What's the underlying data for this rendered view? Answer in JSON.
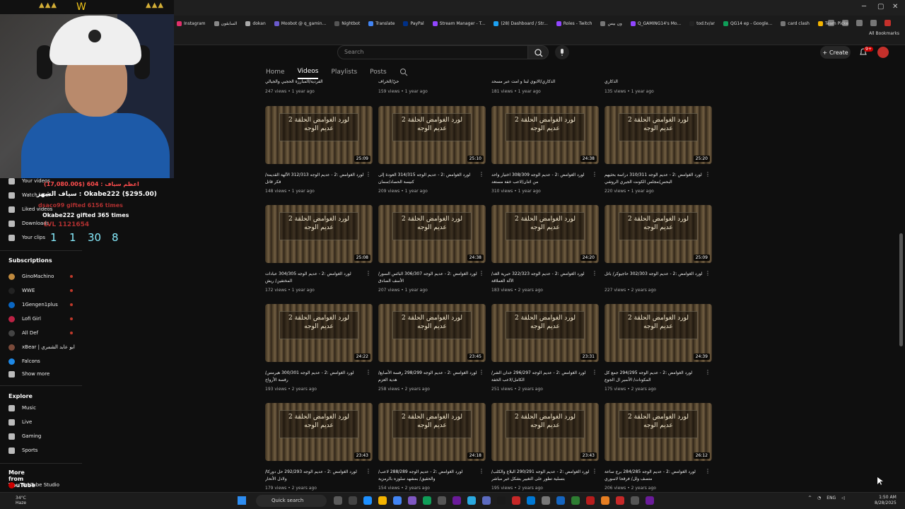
{
  "browser": {
    "bookmarks": [
      "Instagram",
      "السابقون",
      "dokan",
      "Moobot @ q_gamin...",
      "Nightbot",
      "Translate",
      "PayPal",
      "Stream Manager - T...",
      "(28) Dashboard / Str...",
      "Roles - Twitch",
      "ون بيس",
      "Q_GAMING14's Mo...",
      "tod.tv/ar",
      "QG14 ep - Google...",
      "card clash",
      "Team Picker Wheel...",
      "Kick"
    ],
    "all_bookmarks": "All Bookmarks"
  },
  "header": {
    "search_placeholder": "Search",
    "create_label": "Create",
    "notifications_count": "9+"
  },
  "channel_tabs": [
    "Home",
    "Videos",
    "Playlists",
    "Posts"
  ],
  "overlay": {
    "donation_1": "اعظم سياف : 604 ($17,080.00)",
    "donation_2": "سياف الشهر : Okabe222 ($295.00)",
    "gift_1": "dsaco99 gifted 6156 times",
    "gift_2": "Okabe222 gifted 365 times",
    "level": "LVL 1121654",
    "counter_1": "1",
    "counter_2": "1",
    "counter_3": "30",
    "counter_4": "8"
  },
  "sidebar": {
    "you_items": [
      "Your videos",
      "Watch later",
      "Liked videos",
      "Downloads",
      "Your clips"
    ],
    "subscriptions_title": "Subscriptions",
    "subscriptions": [
      "GinoMachino",
      "WWE",
      "1Gengen1plus",
      "Lofi Girl",
      "All Def",
      "xBear | ابو عابد الشمري",
      "Falcons"
    ],
    "show_more": "Show more",
    "explore_title": "Explore",
    "explore": [
      "Music",
      "Live",
      "Gaming",
      "Sports"
    ],
    "more_title": "More from YouTube",
    "more": [
      "YouTube Studio"
    ]
  },
  "top_row": [
    {
      "title": "الفردية/المبارزة الحجبي والجيالي",
      "meta": "247 views • 1 year ago"
    },
    {
      "title": "حيّ/الخراف",
      "meta": "159 views • 1 year ago"
    },
    {
      "title": "الذكاري/الابوي لبنا و امت عبر مسحد",
      "meta": "181 views • 1 year ago"
    },
    {
      "title": "الذكاري",
      "meta": "135 views • 1 year ago"
    }
  ],
  "thumb_art": "لورد الغوامض الحلقة 2 عديم الوجه",
  "videos": [
    {
      "duration": "25:09",
      "title": "لورد الغوامض :2 - عديم الوجه 312/313 الآلهة القديمة/ فكر قاتل",
      "meta": "148 views • 1 year ago"
    },
    {
      "duration": "25:10",
      "title": "لورد الغوامض :2 - عديم الوجه 314/315 العودة إلى كنيسة الحصاد/سمان",
      "meta": "209 views • 1 year ago"
    },
    {
      "duration": "24:38",
      "title": "لورد الغوامض :2 - عديم الوجه 308/309 اختيار واحد من اثنان/لاعب خفة مستعد",
      "meta": "310 views • 1 year ago"
    },
    {
      "duration": "25:20",
      "title": "لورد الغوامض :2 - عديم الوجه 310/311 دراسة بحثيهم البحس/مجلس الكونت الجيري الروشي",
      "meta": "220 views • 1 year ago"
    },
    {
      "duration": "25:08",
      "title": "لورد الغوامض :2 - عديم الوجه 304/305 عبادات المختفين/ ريش",
      "meta": "172 views • 1 year ago"
    },
    {
      "duration": "24:38",
      "title": "لورد الغوامض :2 - عديم الوجه 306/307 البائس السور/ الأسف الصادق",
      "meta": "207 views • 1 year ago"
    },
    {
      "duration": "24:20",
      "title": "لورد الغوامض :2 - عديم الوجه 322/323 حبرية الغد/ الآلة العملاقة",
      "meta": "183 views • 2 years ago"
    },
    {
      "duration": "25:09",
      "title": "لورد الغوامض :2 - عديم الوجه 302/303 حاجيوكر/ باتل",
      "meta": "227 views • 2 years ago"
    },
    {
      "duration": "24:22",
      "title": "لورد الغوامض :2 - عديم الوجه 300/301 هيرمس/ رفسة الأرواح",
      "meta": "193 views • 2 years ago"
    },
    {
      "duration": "23:45",
      "title": "لورد الغوامض :2 - عديم الوجه 298/299 رفسة الأصابع/ هدية العزم",
      "meta": "258 views • 2 years ago"
    },
    {
      "duration": "23:31",
      "title": "لورد الغوامض :2 - عديم الوجه 296/297 خدان الشر/ الكامل/لاعب الخفة",
      "meta": "251 views • 2 years ago"
    },
    {
      "duration": "24:39",
      "title": "لورد الغوامض :2 - عديم الوجه 294/295 جمع كل المكونات/ الأسير ال الجوع",
      "meta": "175 views • 2 years ago"
    },
    {
      "duration": "23:43",
      "title": "لورد الغوامض :2 - عديم الوجه 292/293 حل دوركا/ ولادل الأنحار",
      "meta": "179 views • 2 years ago"
    },
    {
      "duration": "24:18",
      "title": "لورد الغوامض :2 - عديم الوجه 288/289 لاعب/ والحقيق/ بمشهد سلوزه بالرمزية",
      "meta": "154 views • 2 years ago"
    },
    {
      "duration": "23:43",
      "title": "لورد الغوامض :2 - عديم الوجه 290/291 البلاغ والكلب/ بتسلية تطور على التغيير بشكل غير مباشر",
      "meta": "195 views • 2 years ago"
    },
    {
      "duration": "26:12",
      "title": "لورد الغوامض :2 - عديم الوجه 284/285 برج ساعة متصف ولل/ فرقحا لاسوري",
      "meta": "206 views • 2 years ago"
    }
  ],
  "taskbar": {
    "weather_temp": "34°C",
    "weather_desc": "Haze",
    "search_label": "Quick search",
    "lang": "ENG",
    "time": "1:50 AM",
    "date": "8/28/2025"
  },
  "colors": {
    "background": "#0f0f0f",
    "accent": "#cc0000",
    "counter": "#88eeff"
  }
}
